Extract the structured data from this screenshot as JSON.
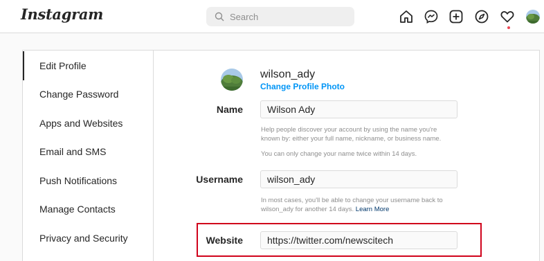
{
  "header": {
    "logo": "Instagram",
    "search_placeholder": "Search",
    "icons": [
      "home-icon",
      "messenger-icon",
      "new-post-icon",
      "explore-icon",
      "activity-heart-icon",
      "profile-avatar"
    ]
  },
  "sidebar": {
    "items": [
      {
        "label": "Edit Profile",
        "active": true
      },
      {
        "label": "Change Password"
      },
      {
        "label": "Apps and Websites"
      },
      {
        "label": "Email and SMS"
      },
      {
        "label": "Push Notifications"
      },
      {
        "label": "Manage Contacts"
      },
      {
        "label": "Privacy and Security"
      }
    ]
  },
  "profile": {
    "username": "wilson_ady",
    "change_photo": "Change Profile Photo"
  },
  "form": {
    "name_label": "Name",
    "name_value": "Wilson Ady",
    "name_help_1": "Help people discover your account by using the name you're known by: either your full name, nickname, or business name.",
    "name_help_2": "You can only change your name twice within 14 days.",
    "username_label": "Username",
    "username_value": "wilson_ady",
    "username_help": "In most cases, you'll be able to change your username back to wilson_ady for another 14 days.",
    "learn_more": "Learn More",
    "website_label": "Website",
    "website_value": "https://twitter.com/newscitech"
  },
  "colors": {
    "link": "#0095f6",
    "highlight": "#d0021b",
    "notification_dot": "#ed4956"
  }
}
